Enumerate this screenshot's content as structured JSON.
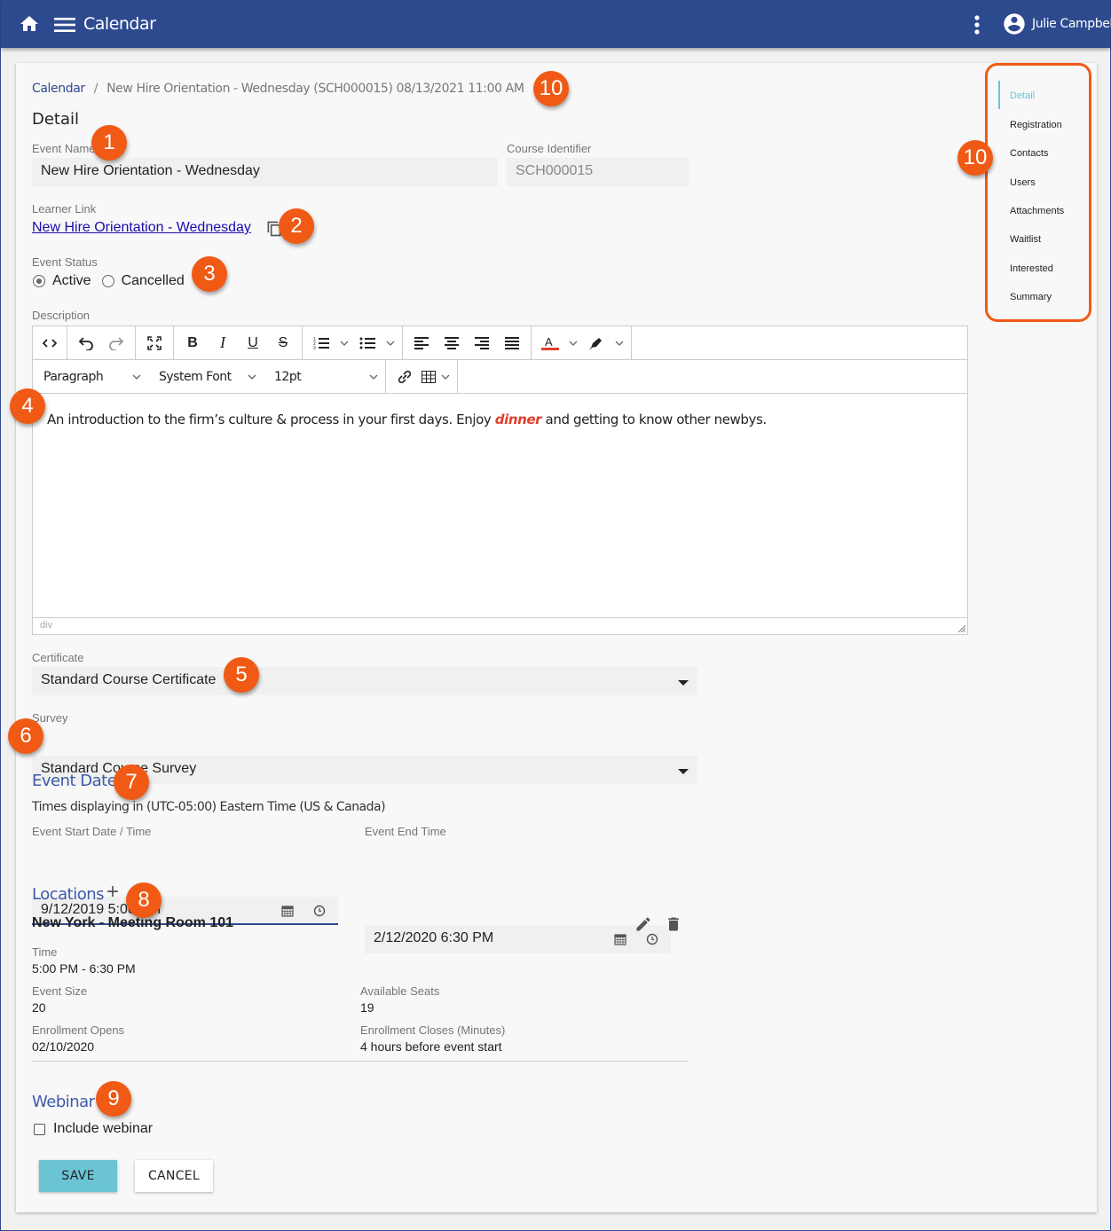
{
  "app": {
    "title": "Calendar",
    "user_name": "Julie Campbell"
  },
  "breadcrumb": {
    "root": "Calendar",
    "separator": "/",
    "current": "New Hire Orientation - Wednesday (SCH000015) 08/13/2021 11:00 AM"
  },
  "detail": {
    "section_title": "Detail",
    "event_name": {
      "label": "Event Name",
      "value": "New Hire Orientation - Wednesday"
    },
    "course_identifier": {
      "label": "Course Identifier",
      "value": "SCH000015"
    },
    "learner_link": {
      "label": "Learner Link",
      "text": "New Hire Orientation - Wednesday"
    },
    "event_status": {
      "label": "Event Status",
      "options": [
        {
          "label": "Active",
          "checked": true
        },
        {
          "label": "Cancelled",
          "checked": false
        }
      ]
    },
    "description": {
      "label": "Description",
      "toolbar": {
        "format": "Paragraph",
        "font": "System Font",
        "size": "12pt"
      },
      "content_before": "An introduction to the firm’s culture & process in your first days. Enjoy ",
      "content_emphasis": "dinner",
      "content_after": " and getting to know other newbys.",
      "status_path": "div"
    },
    "certificate": {
      "label": "Certificate",
      "value": "Standard Course Certificate"
    },
    "survey": {
      "label": "Survey",
      "value": "Standard Course Survey"
    }
  },
  "event_date": {
    "heading": "Event Date",
    "timezone_note": "Times displaying in (UTC-05:00) Eastern Time (US & Canada)",
    "start": {
      "label": "Event Start Date / Time",
      "value": "9/12/2019 5:00 PM"
    },
    "end": {
      "label": "Event End Time",
      "value": "2/12/2020 6:30 PM"
    }
  },
  "locations": {
    "heading": "Locations",
    "add_symbol": "+",
    "items": [
      {
        "name": "New York - Meeting Room 101",
        "time_label": "Time",
        "time_value": "5:00 PM - 6:30 PM",
        "event_size_label": "Event Size",
        "event_size_value": "20",
        "available_seats_label": "Available Seats",
        "available_seats_value": "19",
        "enrollment_opens_label": "Enrollment Opens",
        "enrollment_opens_value": "02/10/2020",
        "enrollment_closes_label": "Enrollment Closes (Minutes)",
        "enrollment_closes_value": "4 hours before event start"
      }
    ]
  },
  "webinar": {
    "heading": "Webinar",
    "include_label": "Include webinar",
    "include_checked": false
  },
  "actions": {
    "save": "SAVE",
    "cancel": "CANCEL"
  },
  "side_nav": {
    "items": [
      {
        "label": "Detail",
        "active": true
      },
      {
        "label": "Registration"
      },
      {
        "label": "Contacts"
      },
      {
        "label": "Users"
      },
      {
        "label": "Attachments"
      },
      {
        "label": "Waitlist"
      },
      {
        "label": "Interested"
      },
      {
        "label": "Summary"
      }
    ]
  },
  "callouts": [
    "1",
    "2",
    "3",
    "4",
    "5",
    "6",
    "7",
    "8",
    "9",
    "10",
    "10"
  ],
  "colors": {
    "header": "#2e4a8f",
    "accent": "#6bc4d4",
    "callout": "#f05a15",
    "emphasis": "#e03e2d",
    "heading": "#3d5aa8"
  }
}
